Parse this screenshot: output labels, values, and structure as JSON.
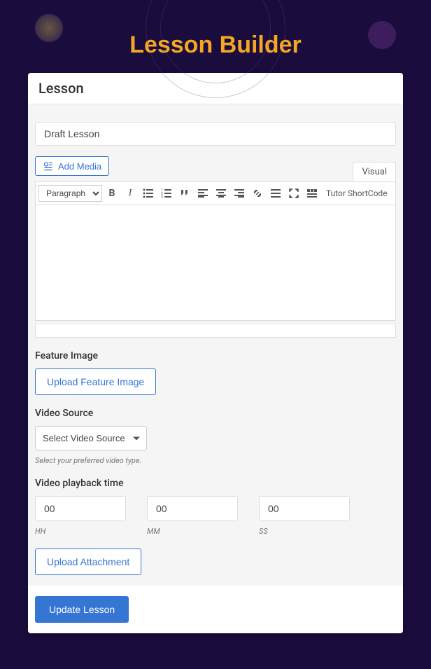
{
  "page": {
    "title": "Lesson Builder"
  },
  "panel": {
    "header": "Lesson"
  },
  "form": {
    "title_value": "Draft Lesson",
    "add_media_label": "Add Media",
    "tabs": {
      "visual": "Visual"
    },
    "format_select": "Paragraph",
    "shortcode_label": "Tutor ShortCode"
  },
  "feature_image": {
    "label": "Feature Image",
    "button": "Upload Feature Image"
  },
  "video_source": {
    "label": "Video Source",
    "selected": "Select Video Source",
    "helper": "Select your preferred video type."
  },
  "playback": {
    "label": "Video playback time",
    "hh": {
      "value": "00",
      "label": "HH"
    },
    "mm": {
      "value": "00",
      "label": "MM"
    },
    "ss": {
      "value": "00",
      "label": "SS"
    }
  },
  "attachment": {
    "button": "Upload Attachment"
  },
  "submit": {
    "button": "Update Lesson"
  }
}
